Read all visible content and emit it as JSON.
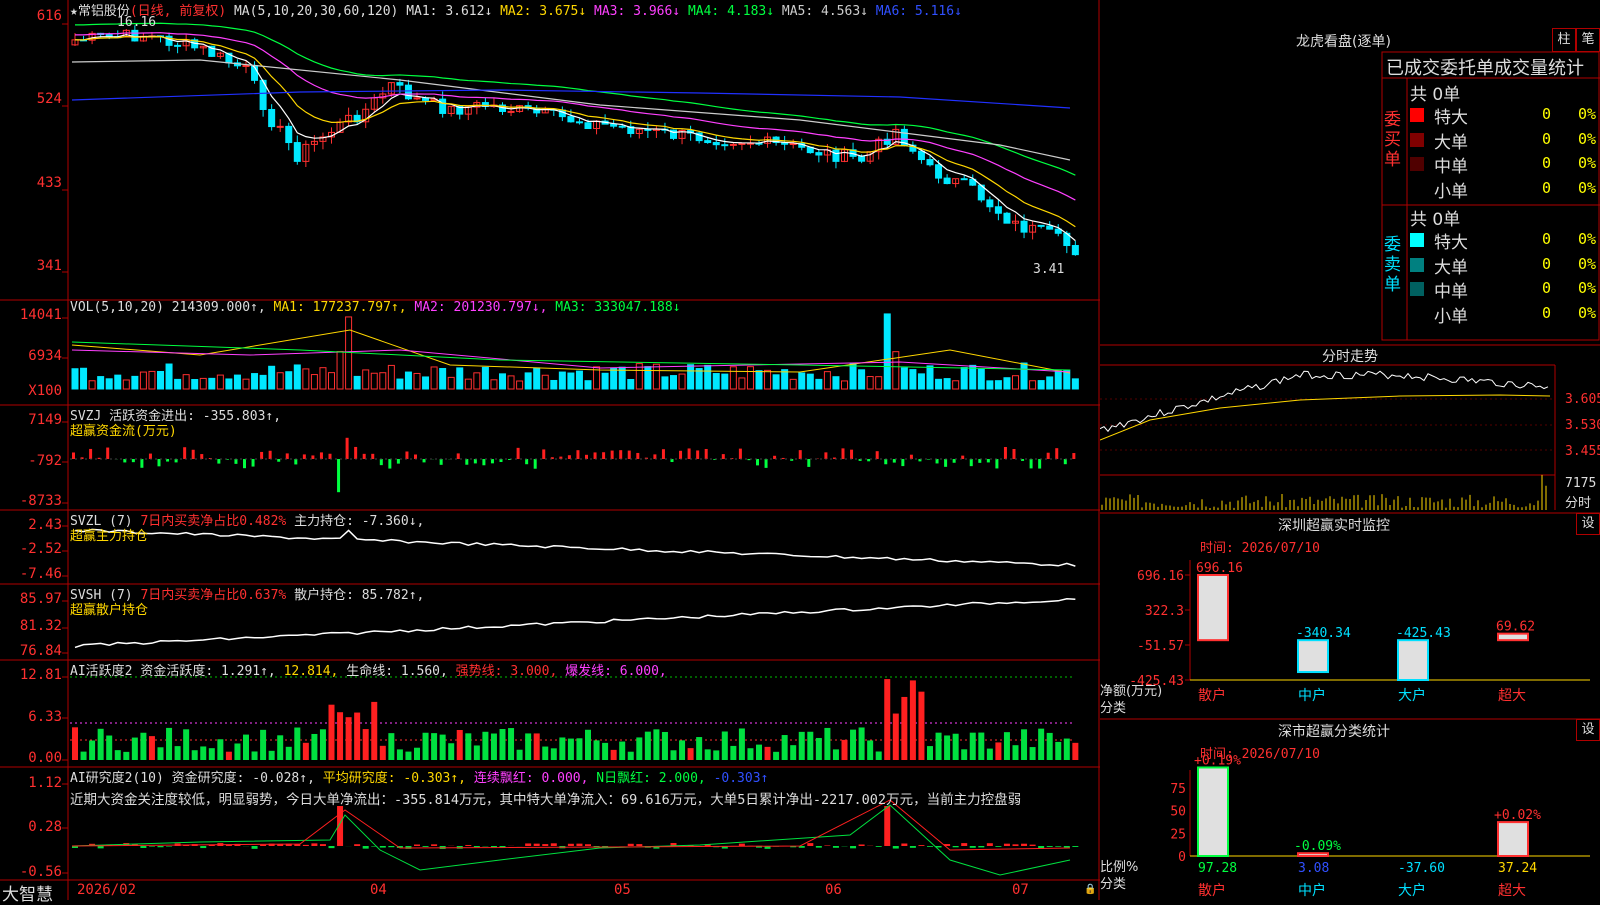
{
  "stock": {
    "name": "常铝股份",
    "mode": "(日线, 前复权)",
    "high_label": "16.16",
    "low_label": "3.41"
  },
  "ma_legend": {
    "prefix": "MA(5,10,20,30,60,120)",
    "ma1": "MA1: 3.612↓",
    "ma2": "MA2: 3.675↓",
    "ma3": "MA3: 3.966↓",
    "ma4": "MA4: 4.183↓",
    "ma5": "MA5: 4.563↓",
    "ma6": "MA6: 5.116↓"
  },
  "price_axis": [
    "616",
    "524",
    "433",
    "341"
  ],
  "vol_legend": {
    "prefix": "VOL(5,10,20)",
    "value": "214309.000↑,",
    "ma1": "MA1: 177237.797↑,",
    "ma2": "MA2: 201230.797↓,",
    "ma3": "MA3: 333047.188↓"
  },
  "vol_axis": [
    "14041",
    "6934",
    "X100"
  ],
  "svzj": {
    "title": "SVZJ",
    "text": "活跃资金进出: -355.803↑,",
    "sub": "超赢资金流(万元)",
    "axis": [
      "7149",
      "-792",
      "-8733"
    ]
  },
  "svzl": {
    "title": "SVZL (7)",
    "text1": "7日内买卖净占比0.482%",
    "text2": "主力持仓: -7.360↓,",
    "sub": "超赢主力持仓",
    "axis": [
      "2.43",
      "-2.52",
      "-7.46"
    ]
  },
  "svsh": {
    "title": "SVSH (7)",
    "text1": "7日内买卖净占比0.637%",
    "text2": "散户持仓: 85.782↑,",
    "sub": "超赢散户持仓",
    "axis": [
      "85.97",
      "81.32",
      "76.84"
    ]
  },
  "ai1": {
    "title": "AI活跃度2",
    "t1": "资金活跃度: 1.291↑,",
    "t2": "12.814,",
    "t3": "生命线: 1.560,",
    "t4": "强势线: 3.000,",
    "t5": "爆发线: 6.000,",
    "axis": [
      "12.81",
      "6.33",
      "0.00"
    ]
  },
  "ai2": {
    "title": "AI研究度2(10)",
    "t1": "资金研究度: -0.028↑,",
    "t2": "平均研究度: -0.303↑,",
    "t3": "连续飘红: 0.000,",
    "t4": "N日飘红: 2.000,",
    "t5": "-0.303↑",
    "comment": "近期大资金关注度较低，明显弱势，今日大单净流出：-355.814万元，其中特大单净流入：69.616万元，大单5日累计净出-2217.002万元，当前主力控盘弱",
    "axis": [
      "1.12",
      "0.28",
      "-0.56"
    ]
  },
  "bottom": {
    "brand": "大智慧",
    "months": [
      "2026/02",
      "04",
      "05",
      "06",
      "07"
    ]
  },
  "lhb": {
    "title": "龙虎看盘(逐单)",
    "btn1": "柱",
    "btn2": "笔",
    "subtitle": "已成交委托单成交量统计",
    "buy_label": "委买单",
    "sell_label": "委卖单",
    "buy_total": "共 0单",
    "sell_total": "共 0单",
    "rows": [
      "特大",
      "大单",
      "中单",
      "小单"
    ],
    "zero": "0",
    "pct": "0%"
  },
  "intraday": {
    "title": "分时走势",
    "axis": [
      "3.605",
      "3.530",
      "3.455"
    ],
    "vol_top": "7175",
    "vol_bottom": "分时"
  },
  "sz_monitor": {
    "title": "深圳超赢实时监控",
    "btn": "设",
    "time": "时间: 2026/07/10",
    "axis": [
      "696.16",
      "322.3",
      "-51.57",
      "-425.43"
    ],
    "ylabel1": "净额(万元)",
    "ylabel2": "分类",
    "categories": [
      "散户",
      "中户",
      "大户",
      "超大"
    ],
    "value_labels": [
      "696.16",
      "-340.34",
      "-425.43",
      "69.62"
    ]
  },
  "sz_class": {
    "title": "深市超赢分类统计",
    "btn": "设",
    "time": "时间: 2026/07/10",
    "axis": [
      "75",
      "50",
      "25",
      "0"
    ],
    "ylabel1": "比例%",
    "ylabel2": "分类",
    "categories": [
      "散户",
      "中户",
      "大户",
      "超大"
    ],
    "top_labels": [
      "+0.19%",
      "-0.09%",
      "",
      "+0.02%"
    ],
    "bottom_labels": [
      "97.28",
      "3.08",
      "-37.60",
      "37.24"
    ]
  },
  "chart_data": [
    {
      "type": "bar",
      "title": "深圳超赢实时监控",
      "categories": [
        "散户",
        "中户",
        "大户",
        "超大"
      ],
      "values": [
        696.16,
        -340.34,
        -425.43,
        69.62
      ],
      "ylabel": "净额(万元)",
      "xlabel": "分类",
      "ylim": [
        -425.43,
        696.16
      ]
    },
    {
      "type": "bar",
      "title": "深市超赢分类统计",
      "categories": [
        "散户",
        "中户",
        "大户",
        "超大"
      ],
      "values": [
        97.28,
        3.08,
        -37.6,
        37.24
      ],
      "ylabel": "比例%",
      "xlabel": "分类",
      "ylim": [
        0,
        100
      ]
    },
    {
      "type": "line",
      "title": "常铝股份 (日线, 前复权)",
      "series": [
        {
          "name": "MA1",
          "values": [
            3.612
          ]
        },
        {
          "name": "MA2",
          "values": [
            3.675
          ]
        },
        {
          "name": "MA3",
          "values": [
            3.966
          ]
        },
        {
          "name": "MA4",
          "values": [
            4.183
          ]
        },
        {
          "name": "MA5",
          "values": [
            4.563
          ]
        },
        {
          "name": "MA6",
          "values": [
            5.116
          ]
        }
      ]
    }
  ]
}
